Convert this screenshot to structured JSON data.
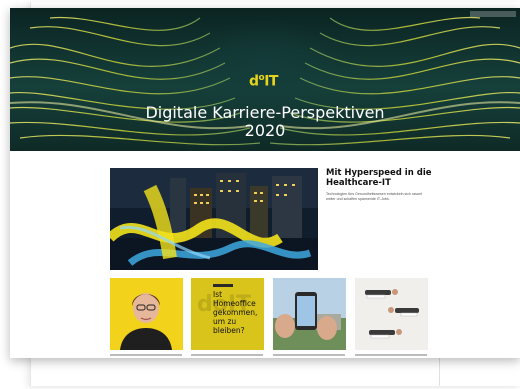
{
  "hero": {
    "logo": {
      "d": "d",
      "o": "o",
      "it": "IT"
    },
    "title_line1": "Digitale Karriere-Perspektiven",
    "title_line2": "2020"
  },
  "feature": {
    "title": "Mit Hyperspeed in die Healthcare-IT",
    "text": "Technologien fürs Gesundheitswesen entwickeln sich rasant weiter und schaffen spannende IT-Jobs."
  },
  "tiles": [
    {
      "name": "portrait-tile"
    },
    {
      "name": "homeoffice-tile",
      "logo": "doIT",
      "question": "Ist Homeoffice gekommen, um zu bleiben?"
    },
    {
      "name": "smartphone-tile"
    },
    {
      "name": "people-lying-tile"
    }
  ],
  "colors": {
    "brand_yellow": "#e7d41c",
    "hero_dark": "#0b2422",
    "feature_yellow": "#f3e21b"
  }
}
